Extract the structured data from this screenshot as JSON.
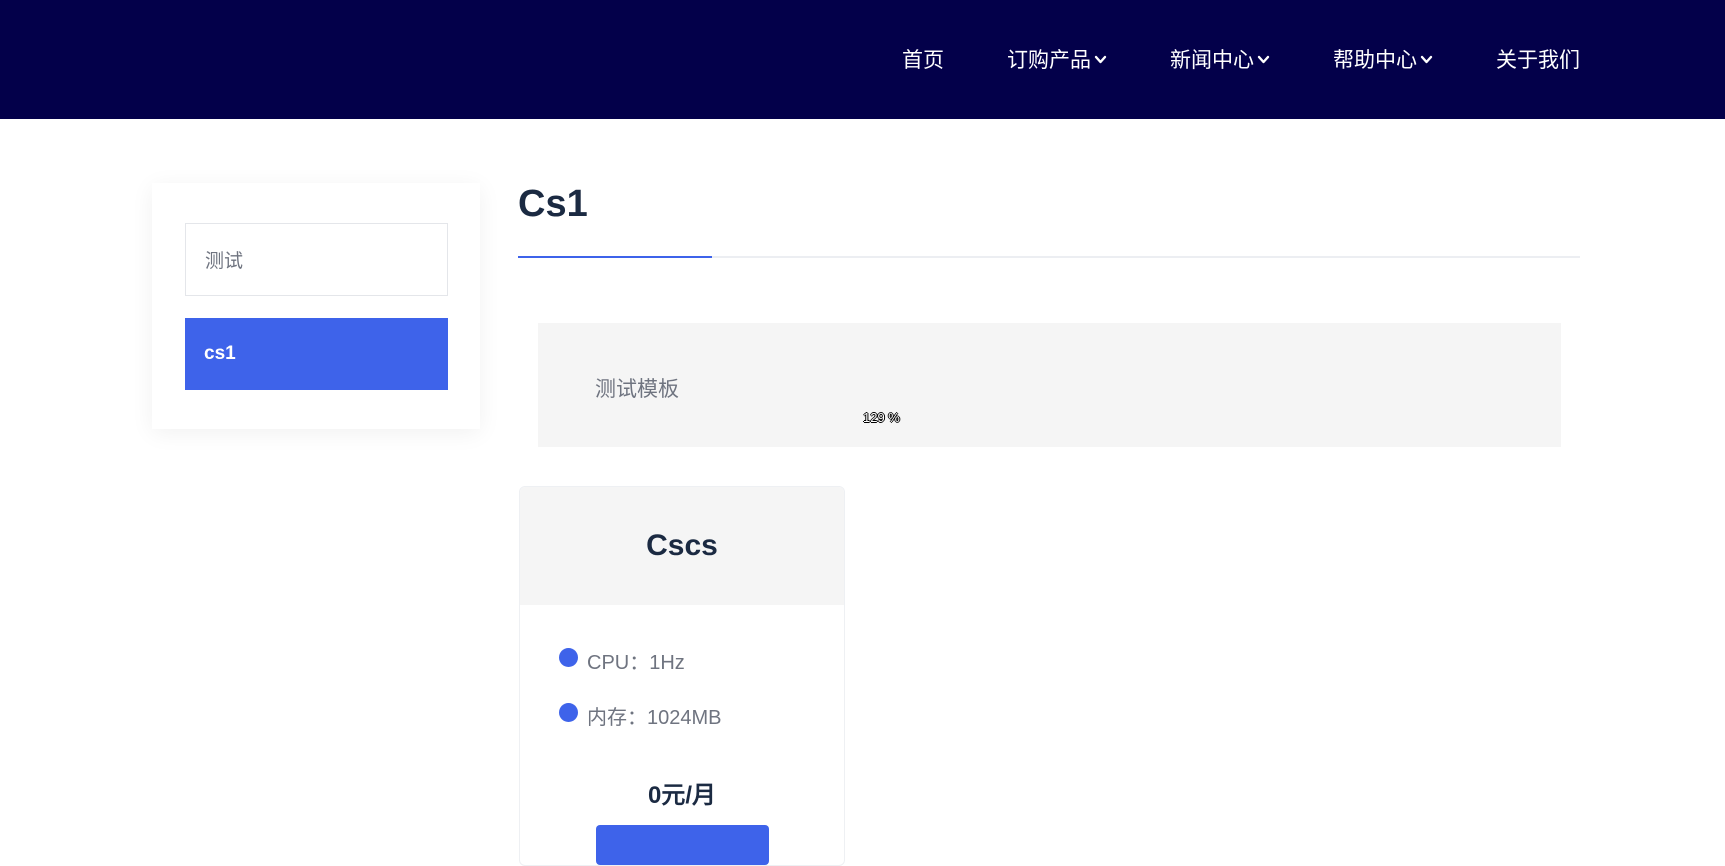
{
  "nav": {
    "items": [
      {
        "label": "首页",
        "dropdown": false
      },
      {
        "label": "订购产品",
        "dropdown": true
      },
      {
        "label": "新闻中心",
        "dropdown": true
      },
      {
        "label": "帮助中心",
        "dropdown": true
      },
      {
        "label": "关于我们",
        "dropdown": false
      }
    ]
  },
  "sidebar": {
    "items": [
      {
        "label": "测试",
        "active": false
      },
      {
        "label": "cs1",
        "active": true
      }
    ]
  },
  "main": {
    "title": "Cs1",
    "description": "测试模板",
    "zoom": "129 %"
  },
  "products": [
    {
      "name": "Cscs",
      "specs": [
        "CPU：1Hz",
        "内存：1024MB"
      ],
      "price": "0元/月"
    }
  ],
  "colors": {
    "header_bg": "#03004a",
    "accent": "#3e63ea",
    "title": "#1b2a42",
    "muted_text": "#6f7480",
    "panel_bg": "#f5f5f5"
  }
}
